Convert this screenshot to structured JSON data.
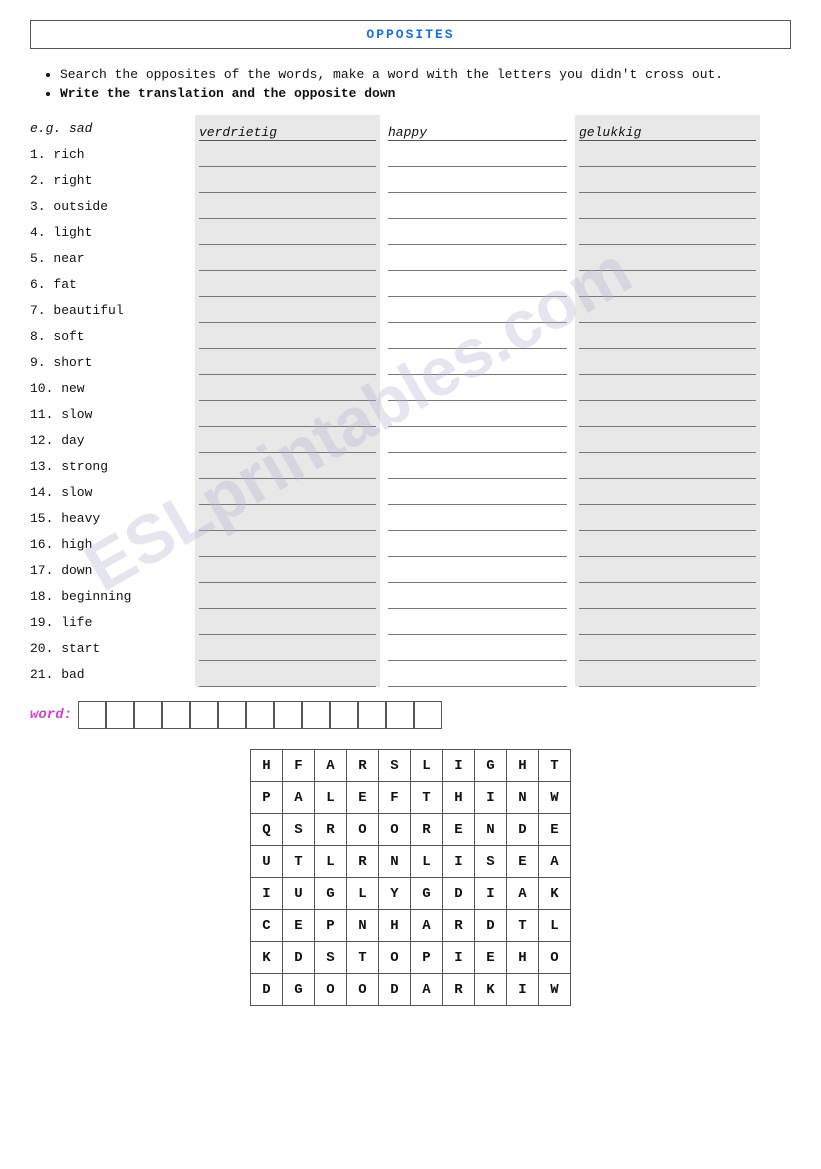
{
  "title": "OPPOSITES",
  "instructions": [
    "Search the opposites of the words, make a word with the letters you didn't cross out.",
    "Write the translation and the opposite down"
  ],
  "example": {
    "word": "e.g. sad",
    "dutch": "verdrietig",
    "english": "happy",
    "answer": "gelukkig"
  },
  "words": [
    "1. rich",
    "2. right",
    "3. outside",
    "4. light",
    "5. near",
    "6. fat",
    "7. beautiful",
    "8. soft",
    "9. short",
    "10. new",
    "11. slow",
    "12. day",
    "13. strong",
    "14. slow",
    "15. heavy",
    "16. high",
    "17. down",
    "18. beginning",
    "19. life",
    "20. start",
    "21. bad"
  ],
  "word_section_label": "word:",
  "word_boxes_count": 13,
  "wordsearch": [
    [
      "H",
      "F",
      "A",
      "R",
      "S",
      "L",
      "I",
      "G",
      "H",
      "T"
    ],
    [
      "P",
      "A",
      "L",
      "E",
      "F",
      "T",
      "H",
      "I",
      "N",
      "W"
    ],
    [
      "Q",
      "S",
      "R",
      "O",
      "O",
      "R",
      "E",
      "N",
      "D",
      "E"
    ],
    [
      "U",
      "T",
      "L",
      "R",
      "N",
      "L",
      "I",
      "S",
      "E",
      "A"
    ],
    [
      "I",
      "U",
      "G",
      "L",
      "Y",
      "G",
      "D",
      "I",
      "A",
      "K"
    ],
    [
      "C",
      "E",
      "P",
      "N",
      "H",
      "A",
      "R",
      "D",
      "T",
      "L"
    ],
    [
      "K",
      "D",
      "S",
      "T",
      "O",
      "P",
      "I",
      "E",
      "H",
      "O"
    ],
    [
      "D",
      "G",
      "O",
      "O",
      "D",
      "A",
      "R",
      "K",
      "I",
      "W"
    ]
  ],
  "colors": {
    "title": "#1a6fdb",
    "word_label": "#cc44cc",
    "border": "#555555"
  }
}
